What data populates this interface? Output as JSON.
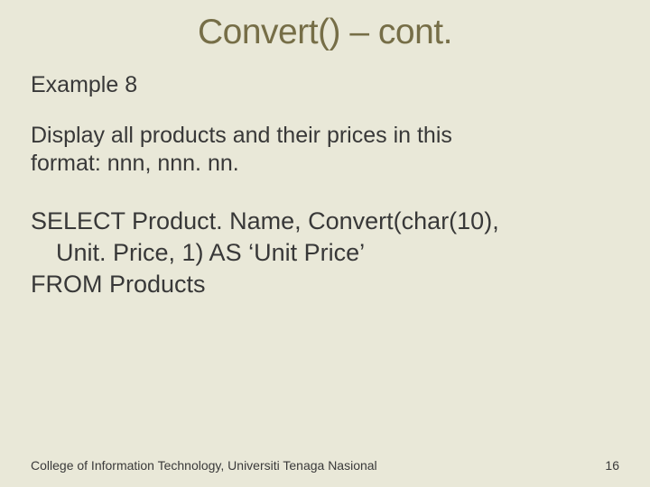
{
  "title": "Convert() – cont.",
  "subtitle": "Example 8",
  "prompt": {
    "line1": "Display all products and their prices in this",
    "line2": "format: nnn, nnn. nn."
  },
  "sql": {
    "line1": "SELECT Product. Name, Convert(char(10),",
    "line2": "Unit. Price, 1) AS ‘Unit Price’",
    "line3": "FROM Products"
  },
  "footer": {
    "org": "College of Information Technology, Universiti Tenaga Nasional",
    "page": "16"
  }
}
